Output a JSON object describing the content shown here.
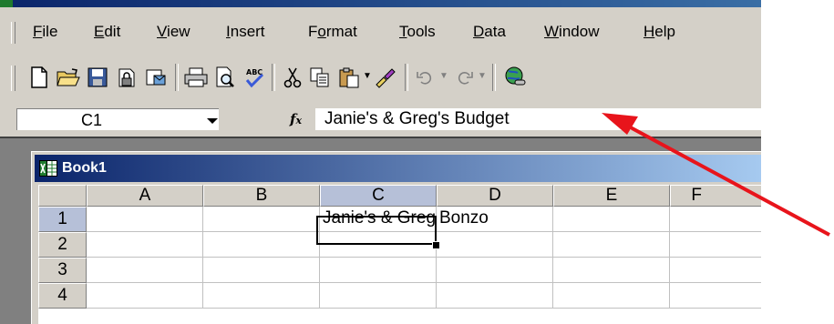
{
  "menu": {
    "items": [
      {
        "pre": "",
        "key": "F",
        "post": "ile"
      },
      {
        "pre": "",
        "key": "E",
        "post": "dit"
      },
      {
        "pre": "",
        "key": "V",
        "post": "iew"
      },
      {
        "pre": "",
        "key": "I",
        "post": "nsert"
      },
      {
        "pre": "F",
        "key": "o",
        "post": "rmat"
      },
      {
        "pre": "",
        "key": "T",
        "post": "ools"
      },
      {
        "pre": "",
        "key": "D",
        "post": "ata"
      },
      {
        "pre": "",
        "key": "W",
        "post": "indow"
      },
      {
        "pre": "",
        "key": "H",
        "post": "elp"
      }
    ]
  },
  "toolbar": {
    "icons": [
      "new-icon",
      "open-icon",
      "save-icon",
      "permission-icon",
      "email-icon",
      "print-icon",
      "print-preview-icon",
      "spelling-icon",
      "cut-icon",
      "copy-icon",
      "paste-icon",
      "format-painter-icon",
      "undo-icon",
      "redo-icon",
      "hyperlink-icon"
    ]
  },
  "formula_bar": {
    "name_box": "C1",
    "formula": "Janie's & Greg's Budget"
  },
  "workbook": {
    "title": "Book1"
  },
  "sheet": {
    "columns": [
      "A",
      "B",
      "C",
      "D",
      "E",
      "F"
    ],
    "rows": [
      "1",
      "2",
      "3",
      "4"
    ],
    "cells": {
      "C1": "Janie's & Greg's Budget",
      "D1": "Bonzo"
    },
    "selected_cell": "C1"
  },
  "colors": {
    "chrome": "#d4d0c8",
    "title_blue": "#0a246a",
    "selected_header": "#b6c0d8",
    "annotation_arrow": "#e8141b"
  }
}
